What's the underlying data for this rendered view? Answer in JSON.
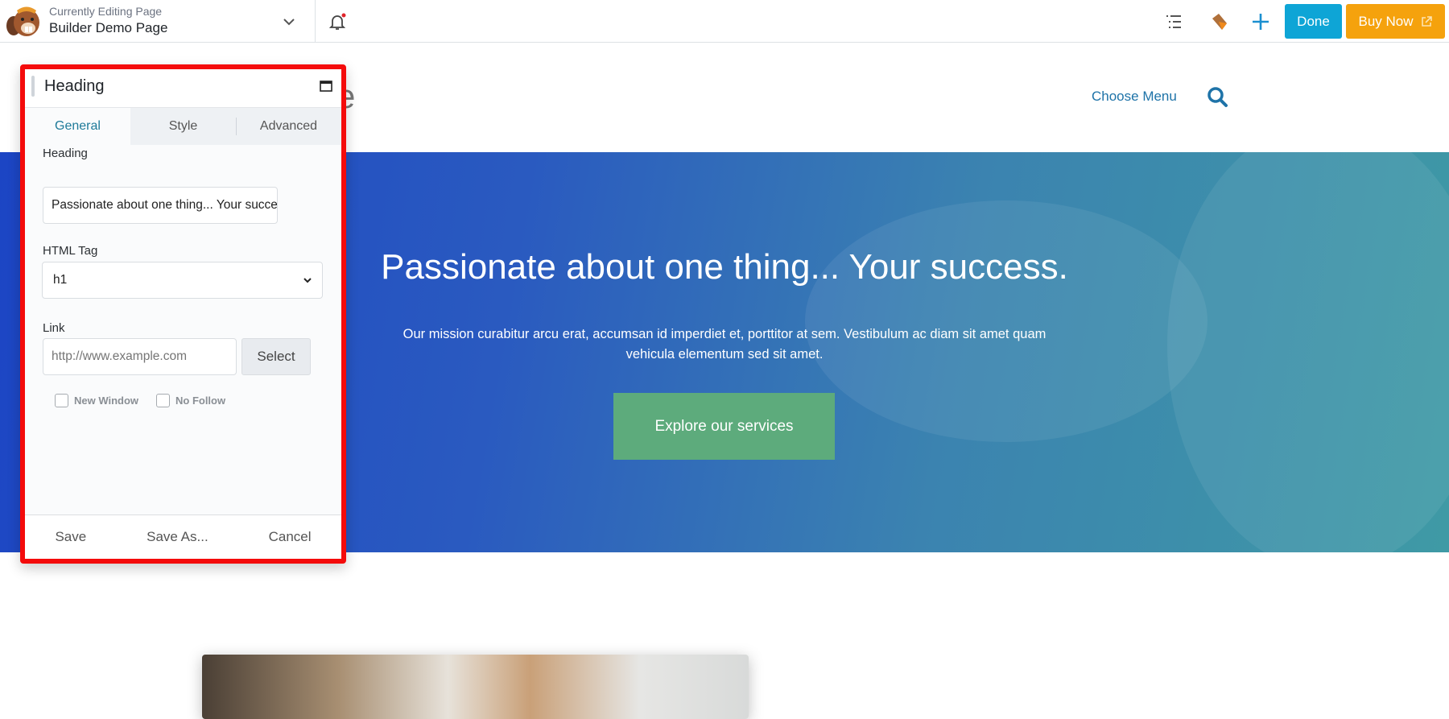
{
  "topbar": {
    "subtitle": "Currently Editing Page",
    "title": "Builder Demo Page",
    "done_label": "Done",
    "buy_label": "Buy Now",
    "accent_done": "#0ea5d6",
    "accent_buy": "#f5a20d"
  },
  "site": {
    "title_fragment": "e",
    "nav_menu": "Choose Menu"
  },
  "hero": {
    "title": "Passionate about one thing... Your success.",
    "text_line1": "Our mission curabitur arcu erat, accumsan id imperdiet et, porttitor at sem. Vestibulum ac diam sit amet quam",
    "text_line2": "vehicula elementum sed sit amet.",
    "button": "Explore our services"
  },
  "panel": {
    "title": "Heading",
    "tabs": [
      {
        "label": "General",
        "active": true
      },
      {
        "label": "Style",
        "active": false
      },
      {
        "label": "Advanced",
        "active": false
      }
    ],
    "heading_label": "Heading",
    "heading_value": "Passionate about one thing... Your success.",
    "tag_label": "HTML Tag",
    "tag_value": "h1",
    "link_label": "Link",
    "link_placeholder": "http://www.example.com",
    "select_label": "Select",
    "new_window": "New Window",
    "no_follow": "No Follow",
    "save": "Save",
    "save_as": "Save As...",
    "cancel": "Cancel"
  }
}
